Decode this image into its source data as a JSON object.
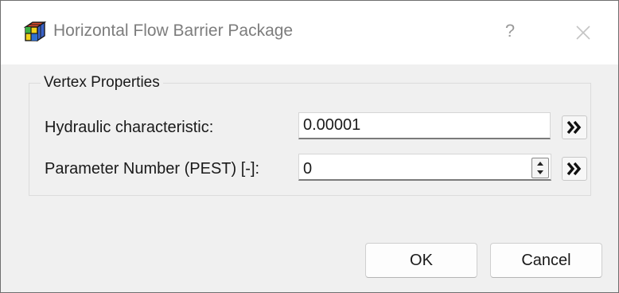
{
  "window": {
    "title": "Horizontal Flow Barrier Package",
    "help_label": "?",
    "app_icon": "cube-icon",
    "close_icon": "close-icon"
  },
  "group": {
    "title": "Vertex Properties",
    "fields": [
      {
        "label": "Hydraulic characteristic:",
        "value": "0.00001",
        "action_icon": "double-chevron-right-icon"
      },
      {
        "label": "Parameter Number (PEST) [-]:",
        "value": "0",
        "action_icon": "double-chevron-right-icon"
      }
    ]
  },
  "buttons": {
    "ok": "OK",
    "cancel": "Cancel"
  }
}
